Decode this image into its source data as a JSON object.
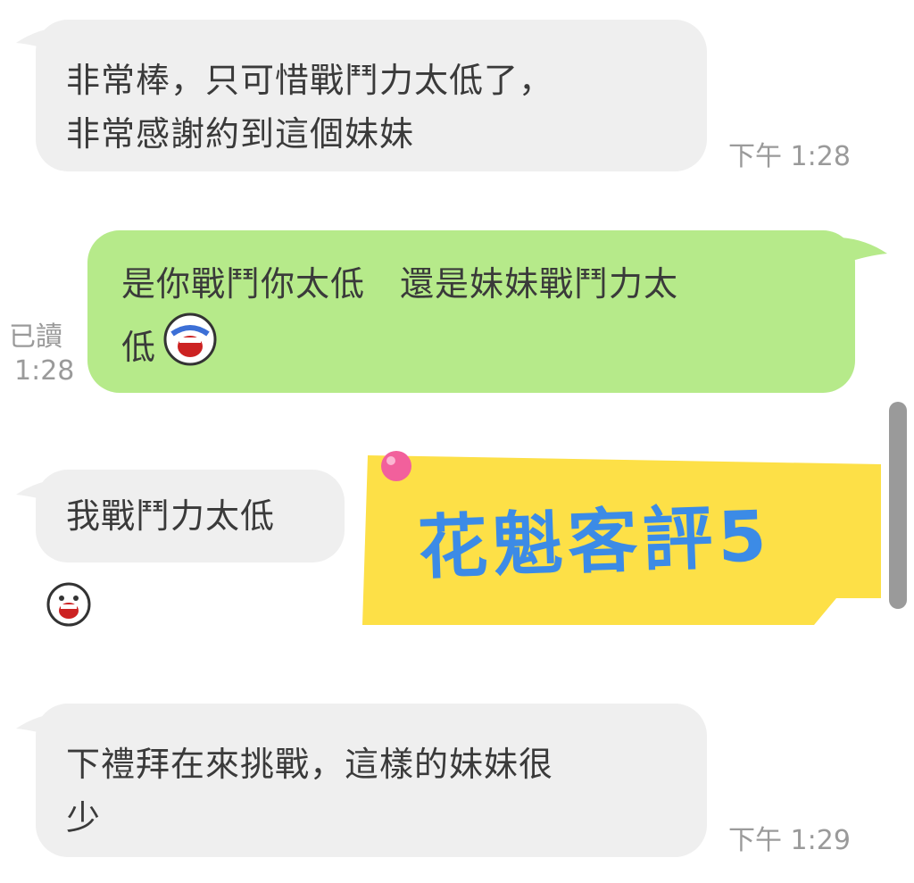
{
  "messages": [
    {
      "id": "m1",
      "lines": [
        "非常棒，只可惜戰鬥力太低了，",
        "非常感謝約到這個妹妹"
      ],
      "time": "下午 1:28"
    },
    {
      "id": "m2",
      "lines": [
        "是你戰鬥你太低　還是妹妹戰鬥力太",
        "低"
      ],
      "read_label": "已讀",
      "read_time": "1:28"
    },
    {
      "id": "m3",
      "lines": [
        "我戰鬥力太低"
      ]
    },
    {
      "id": "m4",
      "lines": [
        "下禮拜在來挑戰，這樣的妹妹很",
        "少"
      ],
      "time": "下午 1:29"
    }
  ],
  "stamp": {
    "text": "花魁客評5",
    "bg_color": "#fde047",
    "text_color": "#3c8be6",
    "pin_color": "#f2609c"
  },
  "colors": {
    "incoming_bubble": "#efefef",
    "outgoing_bubble": "#b6ea8a"
  },
  "icons": [
    "laughing-face-icon",
    "laughing-face-icon"
  ]
}
